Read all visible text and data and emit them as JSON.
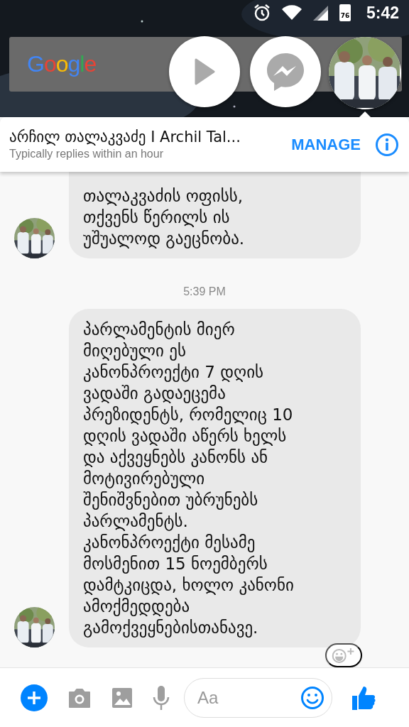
{
  "status_bar": {
    "time": "5:42",
    "battery": "76"
  },
  "home_screen": {
    "search_widget": "Google"
  },
  "chat_heads": [
    {
      "kind": "play"
    },
    {
      "kind": "messenger"
    },
    {
      "kind": "picture"
    }
  ],
  "conversation_header": {
    "title": "არჩილ თალაკვაძე I Archil Tal...",
    "subtitle": "Typically replies within an hour",
    "action": "MANAGE"
  },
  "messages": [
    {
      "kind": "message",
      "text": "თალაკვაძის ოფისს,\nთქვენს წერილს ის\nუშუალოდ გაეცნობა.",
      "reaction_prompt": false
    },
    {
      "kind": "timestamp",
      "text": "5:39 PM"
    },
    {
      "kind": "message",
      "text": "პარლამენტის მიერ\nმიღებული ეს\nკანონპროექტი 7 დღის\nვადაში გადაეცემა\nპრეზიდენტს, რომელიც 10\nდღის ვადაში აწერს ხელს\nდა აქვეყნებს კანონს ან\nმოტივირებული\nშენიშვნებით უბრუნებს\nპარლამენტს.\nკანონპროექტი მესამე\nმოსმენით 15 ნოემბერს\nდამტკიცდა, ხოლო კანონი\nამოქმედდება\nგამოქვეყნებისთანავე.",
      "reaction_prompt": true
    }
  ],
  "composer": {
    "placeholder": "Aa"
  }
}
